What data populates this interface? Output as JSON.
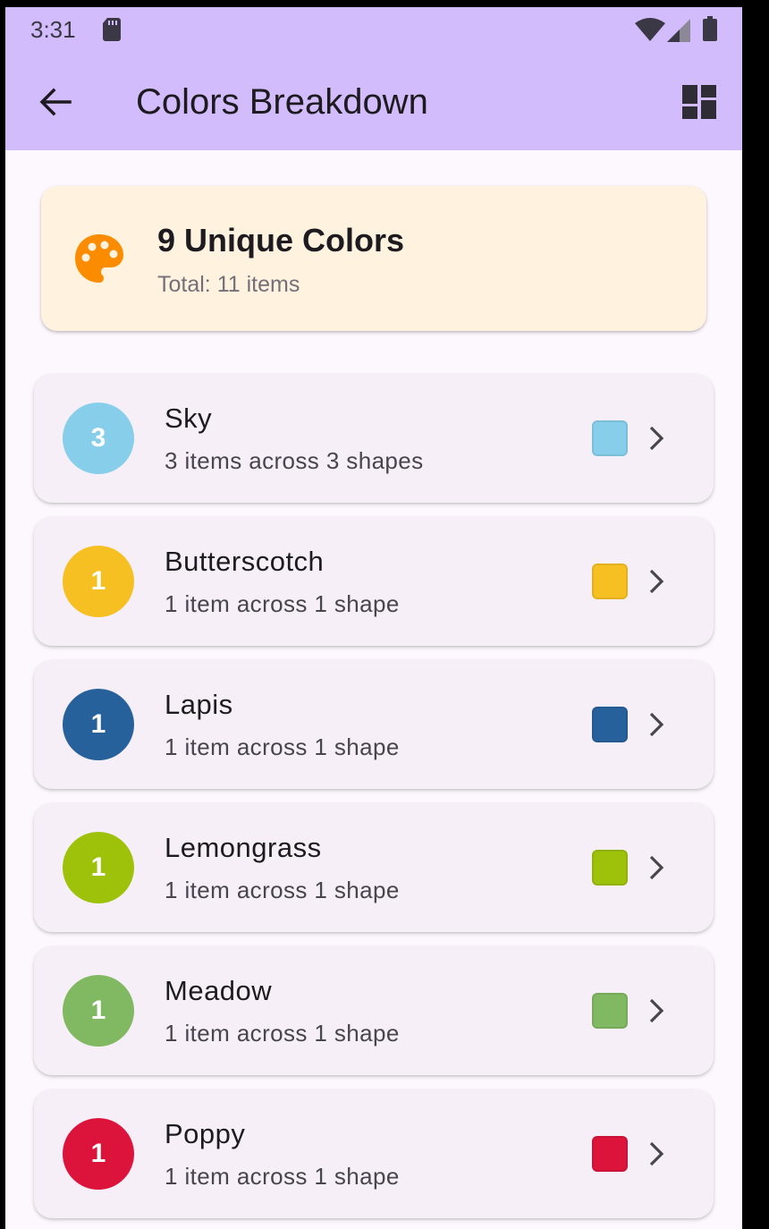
{
  "status_bar": {
    "time": "3:31"
  },
  "app_bar": {
    "title": "Colors Breakdown"
  },
  "summary": {
    "title": "9 Unique Colors",
    "subtitle": "Total: 11 items",
    "icon_color": "#FB8C00"
  },
  "colors": [
    {
      "name": "Sky",
      "count": "3",
      "description": "3 items across 3 shapes",
      "color": "#87CEEB"
    },
    {
      "name": "Butterscotch",
      "count": "1",
      "description": "1 item across 1 shape",
      "color": "#F7C022"
    },
    {
      "name": "Lapis",
      "count": "1",
      "description": "1 item across 1 shape",
      "color": "#26619C"
    },
    {
      "name": "Lemongrass",
      "count": "1",
      "description": "1 item across 1 shape",
      "color": "#9DC209"
    },
    {
      "name": "Meadow",
      "count": "1",
      "description": "1 item across 1 shape",
      "color": "#81B962"
    },
    {
      "name": "Poppy",
      "count": "1",
      "description": "1 item across 1 shape",
      "color": "#DC143C"
    }
  ]
}
